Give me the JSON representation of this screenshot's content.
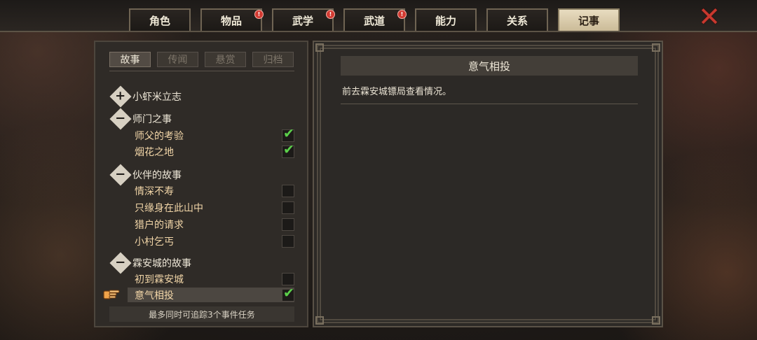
{
  "tabs": [
    {
      "label": "角色",
      "badge": false
    },
    {
      "label": "物品",
      "badge": true
    },
    {
      "label": "武学",
      "badge": true
    },
    {
      "label": "武道",
      "badge": true
    },
    {
      "label": "能力",
      "badge": false
    },
    {
      "label": "关系",
      "badge": false
    },
    {
      "label": "记事",
      "badge": false,
      "active": true
    }
  ],
  "subtabs": [
    {
      "label": "故事",
      "active": true
    },
    {
      "label": "传闻"
    },
    {
      "label": "悬赏"
    },
    {
      "label": "归档"
    }
  ],
  "groups": [
    {
      "sign": "+",
      "title": "小虾米立志"
    },
    {
      "sign": "−",
      "title": "师门之事"
    },
    {
      "sign": "−",
      "title": "伙伴的故事"
    },
    {
      "sign": "−",
      "title": "霖安城的故事"
    }
  ],
  "items": [
    {
      "label": "师父的考验",
      "checked": true
    },
    {
      "label": "烟花之地",
      "checked": true
    },
    {
      "label": "情深不寿",
      "checked": false
    },
    {
      "label": "只缘身在此山中",
      "checked": false
    },
    {
      "label": "猎户的请求",
      "checked": false
    },
    {
      "label": "小村乞丐",
      "checked": false
    },
    {
      "label": "初到霖安城",
      "checked": false
    },
    {
      "label": "意气相投",
      "checked": true,
      "selected": true
    }
  ],
  "footer_note": "最多同时可追踪3个事件任务",
  "detail": {
    "title": "意气相投",
    "description": "前去霖安城镖局查看情况。"
  },
  "close_icon": "close-x-icon",
  "colors": {
    "check": "#5bd04a",
    "badge": "#d23a32",
    "active_tab": "#e8dcc0"
  }
}
